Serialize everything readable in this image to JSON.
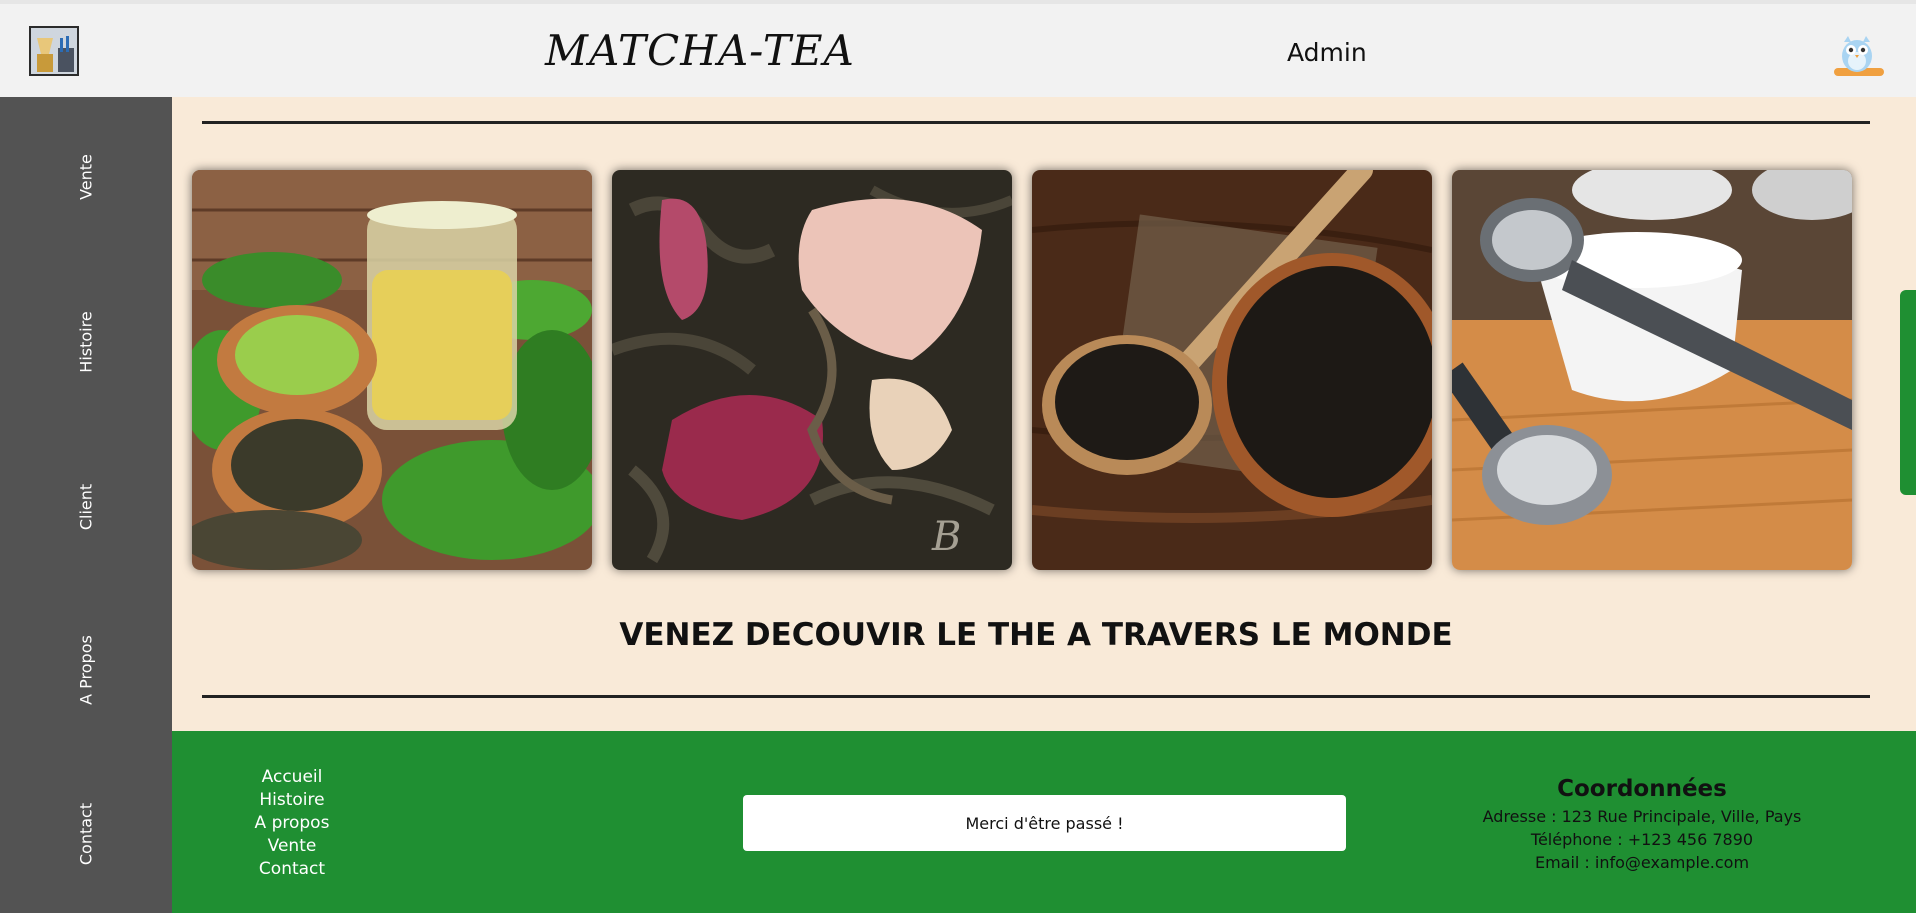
{
  "header": {
    "brand": "MATCHA-TEA",
    "user_label": "Admin",
    "logo_icon": "tea-tools-logo-icon",
    "avatar_icon": "owl-avatar-icon"
  },
  "sidebar": {
    "items": [
      {
        "label": "Vente"
      },
      {
        "label": "Histoire"
      },
      {
        "label": "Client"
      },
      {
        "label": "A Propos"
      },
      {
        "label": "Contact"
      }
    ]
  },
  "gallery": {
    "images": [
      {
        "name": "matcha-green-tea-image"
      },
      {
        "name": "dried-tea-rose-petals-image"
      },
      {
        "name": "black-tea-spoon-bowl-image"
      },
      {
        "name": "tea-measuring-spoon-image"
      }
    ]
  },
  "main": {
    "tagline": "VENEZ DECOUVIR LE THE A TRAVERS LE MONDE"
  },
  "footer": {
    "links": [
      "Accueil",
      "Histoire",
      "A propos",
      "Vente",
      "Contact"
    ],
    "thanks_message": "Merci d'être passé !",
    "contact": {
      "title": "Coordonnées",
      "address": "Adresse : 123 Rue Principale, Ville, Pays",
      "phone": "Téléphone : +123 456 7890",
      "email": "Email : info@example.com"
    }
  },
  "colors": {
    "header_bg": "#f2f2f2",
    "sidebar_bg": "#535353",
    "main_bg": "#f9ead8",
    "footer_bg": "#1f8f32",
    "text": "#111111"
  }
}
